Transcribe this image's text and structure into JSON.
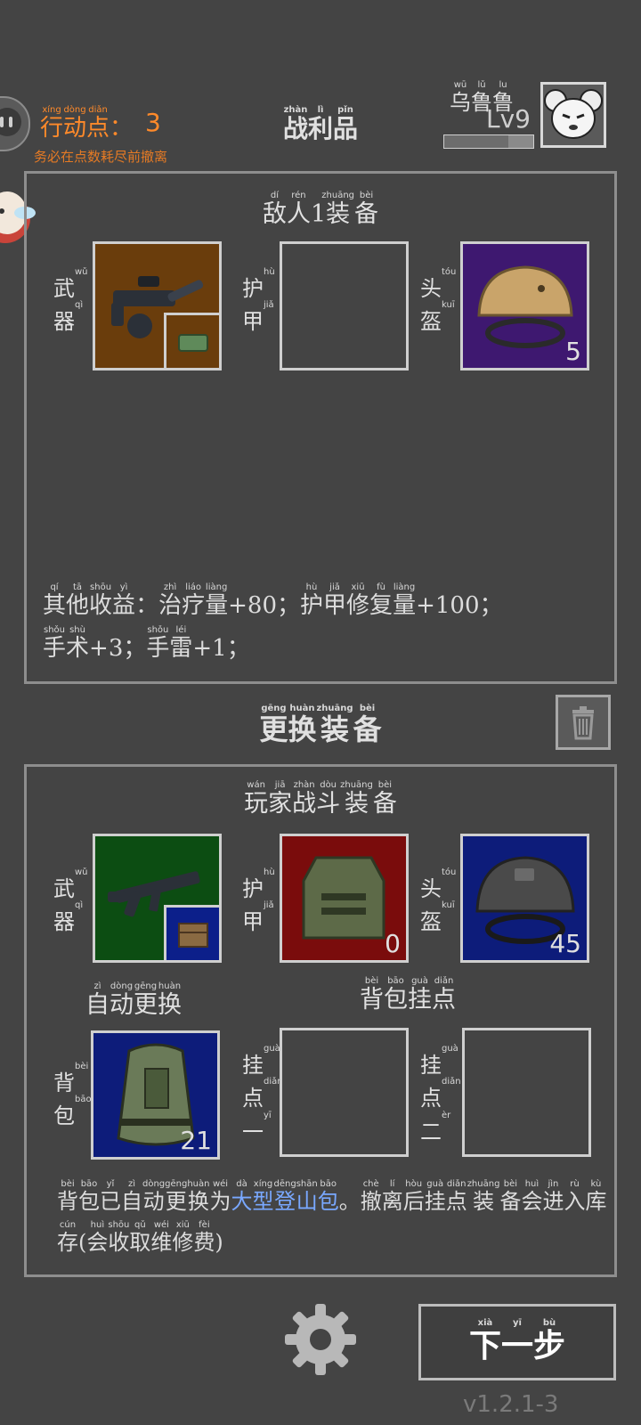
{
  "header": {
    "action_label": "行动点：",
    "action_value": "3",
    "action_hint": "务必在点数耗尽前撤离",
    "title": "战利品",
    "player_name": "乌鲁鲁",
    "player_level": "Lv9",
    "xp_fraction": 0.72
  },
  "enemy_panel": {
    "title": "敌人1装备",
    "weapon_label": "武器",
    "armor_label": "护甲",
    "helmet_label": "头盔",
    "helmet_count": "5",
    "benefits_line1": "其他收益：治疗量+80；护甲修复量+100；",
    "benefits_line2": "手术+3；手雷+1；"
  },
  "change_section": {
    "title": "更换装备"
  },
  "player_panel": {
    "title": "玩家战斗装备",
    "weapon_label": "武器",
    "armor_label": "护甲",
    "helmet_label": "头盔",
    "armor_count": "0",
    "helmet_count": "45",
    "auto_change": "自动更换",
    "backpack_mounts": "背包挂点",
    "backpack_label": "背包",
    "backpack_count": "21",
    "mount1_label": "挂点一",
    "mount2_label": "挂点二",
    "notice_pre": "背包已自动更换为",
    "notice_highlight": "大型登山包",
    "notice_post": "。撤离后挂点装备会进入库存(会收取维修费)"
  },
  "footer": {
    "next_button": "下一步",
    "version": "v1.2.1-3"
  },
  "icons": [
    "gear-icon",
    "trash-icon"
  ],
  "colors": {
    "background": "#444444",
    "accent_orange": "#ff8a2a",
    "highlight_blue": "#79a8ff"
  }
}
